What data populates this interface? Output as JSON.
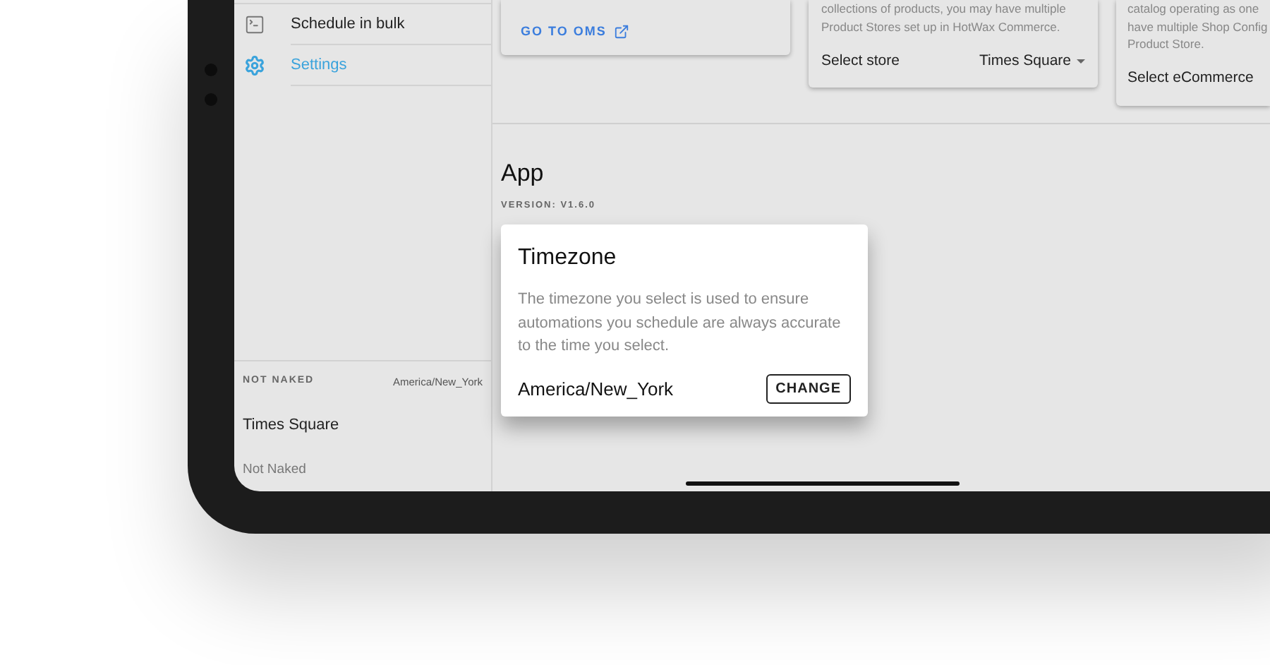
{
  "sidebar": {
    "items": [
      {
        "kind": "terminal",
        "label": "Schedule in bulk",
        "selected": false
      },
      {
        "kind": "settings",
        "label": "Settings",
        "selected": true
      }
    ],
    "footer": {
      "instance": "NOT NAKED",
      "timezone": "America/New_York",
      "store": "Times Square",
      "company": "Not Naked"
    }
  },
  "cards": [
    {
      "link": "GO TO OMS"
    },
    {
      "lines": [
        "collections of products, you may have multiple",
        "Product Stores set up in HotWax Commerce."
      ],
      "label": "Select store",
      "value": "Times Square"
    },
    {
      "lines": [
        "catalog operating as one",
        "have multiple Shop Config",
        "Product Store."
      ],
      "label": "Select eCommerce"
    }
  ],
  "app": {
    "title": "App",
    "version": "VERSION: V1.6.0"
  },
  "timezone_card": {
    "title": "Timezone",
    "description": "The timezone you select is used to ensure automations you schedule are always accurate to the time you select.",
    "value": "America/New_York",
    "button": "CHANGE"
  }
}
